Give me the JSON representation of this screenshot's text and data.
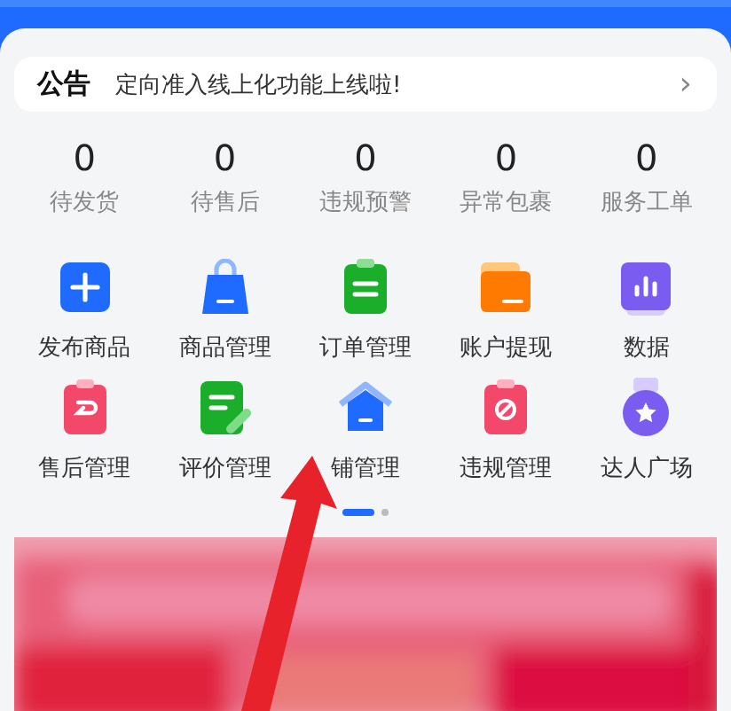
{
  "notice": {
    "label": "公告",
    "text": "定向准入线上化功能上线啦!",
    "chevron": "›"
  },
  "stats": [
    {
      "value": "0",
      "label": "待发货"
    },
    {
      "value": "0",
      "label": "待售后"
    },
    {
      "value": "0",
      "label": "违规预警"
    },
    {
      "value": "0",
      "label": "异常包裹"
    },
    {
      "value": "0",
      "label": "服务工单"
    }
  ],
  "shortcuts": [
    {
      "kind": "plus",
      "color": "#1f6bff",
      "label": "发布商品"
    },
    {
      "kind": "bag",
      "color": "#1f6bff",
      "label": "商品管理"
    },
    {
      "kind": "clipboard",
      "color": "#1aae2a",
      "label": "订单管理"
    },
    {
      "kind": "folder",
      "color": "#ff7a00",
      "label": "账户提现"
    },
    {
      "kind": "chart",
      "color": "#7a5cf0",
      "label": "数据"
    },
    {
      "kind": "return",
      "color": "#f2496a",
      "label": "售后管理"
    },
    {
      "kind": "edit",
      "color": "#1aae2a",
      "label": "评价管理"
    },
    {
      "kind": "home",
      "color": "#1f6bff",
      "label": "铺管理"
    },
    {
      "kind": "forbidden",
      "color": "#f2496a",
      "label": "违规管理"
    },
    {
      "kind": "medal",
      "color": "#7a5cf0",
      "label": "达人广场"
    }
  ],
  "pager": [
    {
      "selected": true
    },
    {
      "selected": false
    }
  ]
}
